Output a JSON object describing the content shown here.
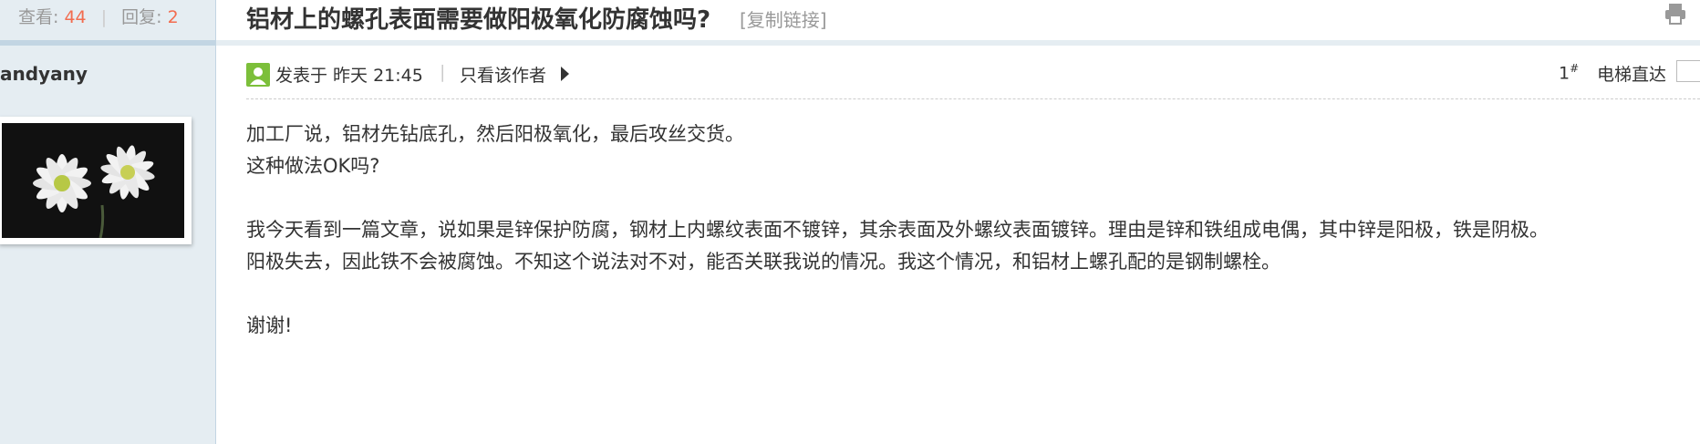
{
  "stats": {
    "views_label": "查看:",
    "views": "44",
    "replies_label": "回复:",
    "replies": "2"
  },
  "author": {
    "name": "andyany"
  },
  "thread": {
    "title": "铝材上的螺孔表面需要做阳极氧化防腐蚀吗?",
    "copy_link": "[复制链接]"
  },
  "post": {
    "posted": "发表于 昨天 21:45",
    "separator": "|",
    "only_author": "只看该作者",
    "floor": "1",
    "floor_mark": "#",
    "jump_label": "电梯直达",
    "lines": [
      "加工厂说，铝材先钻底孔，然后阳极氧化，最后攻丝交货。",
      "这种做法OK吗?",
      "我今天看到一篇文章，说如果是锌保护防腐，钢材上内螺纹表面不镀锌，其余表面及外螺纹表面镀锌。理由是锌和铁组成电偶，其中锌是阳极，铁是阴极。",
      "阳极失去，因此铁不会被腐蚀。不知这个说法对不对，能否关联我说的情况。我这个情况，和铝材上螺孔配的是钢制螺栓。",
      "谢谢!"
    ]
  },
  "icons": {
    "print": "print-icon",
    "online": "online-status-icon",
    "arrow": "triangle-right-icon"
  },
  "colors": {
    "highlight": "#f26c4f",
    "sidebar": "#e5edf2",
    "border": "#c2d5e3"
  }
}
